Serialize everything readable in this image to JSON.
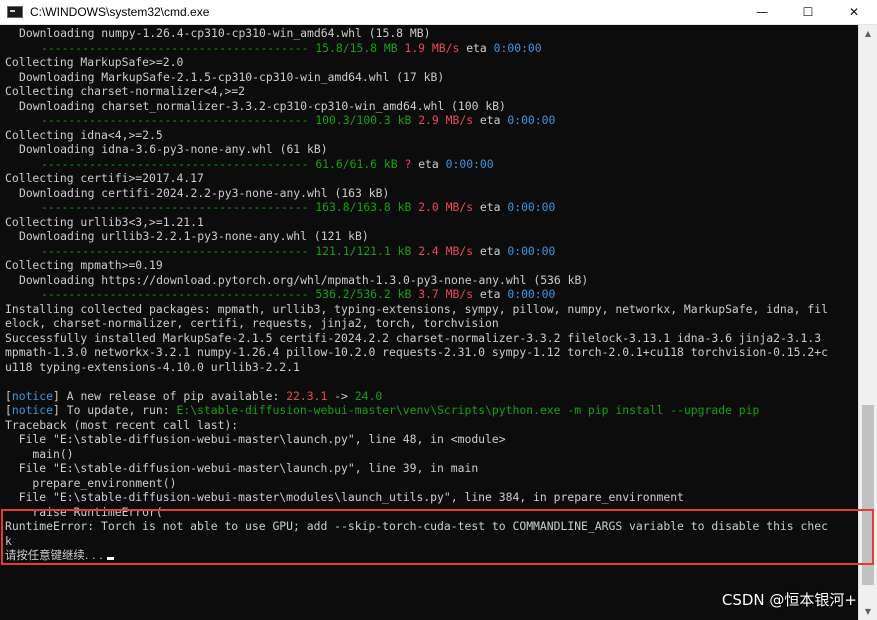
{
  "window": {
    "title": "C:\\WINDOWS\\system32\\cmd.exe",
    "minimize_glyph": "—",
    "maximize_glyph": "☐",
    "close_glyph": "✕"
  },
  "console": {
    "lines": [
      {
        "type": "plain",
        "indent": true,
        "text": "Downloading numpy-1.26.4-cp310-cp310-win_amd64.whl (15.8 MB)"
      },
      {
        "type": "progress",
        "bar": "---------------------------------------",
        "size": "15.8/15.8 MB",
        "speed": "1.9 MB/s",
        "eta_label": "eta",
        "eta": "0:00:00"
      },
      {
        "type": "plain",
        "indent": false,
        "text": "Collecting MarkupSafe>=2.0"
      },
      {
        "type": "plain",
        "indent": true,
        "text": "Downloading MarkupSafe-2.1.5-cp310-cp310-win_amd64.whl (17 kB)"
      },
      {
        "type": "plain",
        "indent": false,
        "text": "Collecting charset-normalizer<4,>=2"
      },
      {
        "type": "plain",
        "indent": true,
        "text": "Downloading charset_normalizer-3.3.2-cp310-cp310-win_amd64.whl (100 kB)"
      },
      {
        "type": "progress",
        "bar": "---------------------------------------",
        "size": "100.3/100.3 kB",
        "speed": "2.9 MB/s",
        "eta_label": "eta",
        "eta": "0:00:00"
      },
      {
        "type": "plain",
        "indent": false,
        "text": "Collecting idna<4,>=2.5"
      },
      {
        "type": "plain",
        "indent": true,
        "text": "Downloading idna-3.6-py3-none-any.whl (61 kB)"
      },
      {
        "type": "progress",
        "bar": "---------------------------------------",
        "size": "61.6/61.6 kB",
        "speed": "?",
        "eta_label": "eta",
        "eta": "0:00:00"
      },
      {
        "type": "plain",
        "indent": false,
        "text": "Collecting certifi>=2017.4.17"
      },
      {
        "type": "plain",
        "indent": true,
        "text": "Downloading certifi-2024.2.2-py3-none-any.whl (163 kB)"
      },
      {
        "type": "progress",
        "bar": "---------------------------------------",
        "size": "163.8/163.8 kB",
        "speed": "2.0 MB/s",
        "eta_label": "eta",
        "eta": "0:00:00"
      },
      {
        "type": "plain",
        "indent": false,
        "text": "Collecting urllib3<3,>=1.21.1"
      },
      {
        "type": "plain",
        "indent": true,
        "text": "Downloading urllib3-2.2.1-py3-none-any.whl (121 kB)"
      },
      {
        "type": "progress",
        "bar": "---------------------------------------",
        "size": "121.1/121.1 kB",
        "speed": "2.4 MB/s",
        "eta_label": "eta",
        "eta": "0:00:00"
      },
      {
        "type": "plain",
        "indent": false,
        "text": "Collecting mpmath>=0.19"
      },
      {
        "type": "plain",
        "indent": true,
        "text": "Downloading https://download.pytorch.org/whl/mpmath-1.3.0-py3-none-any.whl (536 kB)"
      },
      {
        "type": "progress",
        "bar": "---------------------------------------",
        "size": "536.2/536.2 kB",
        "speed": "3.7 MB/s",
        "eta_label": "eta",
        "eta": "0:00:00"
      },
      {
        "type": "plain",
        "indent": false,
        "text": "Installing collected packages: mpmath, urllib3, typing-extensions, sympy, pillow, numpy, networkx, MarkupSafe, idna, fil"
      },
      {
        "type": "plain",
        "indent": false,
        "text": "elock, charset-normalizer, certifi, requests, jinja2, torch, torchvision"
      },
      {
        "type": "plain",
        "indent": false,
        "text": "Successfully installed MarkupSafe-2.1.5 certifi-2024.2.2 charset-normalizer-3.3.2 filelock-3.13.1 idna-3.6 jinja2-3.1.3"
      },
      {
        "type": "plain",
        "indent": false,
        "text": "mpmath-1.3.0 networkx-3.2.1 numpy-1.26.4 pillow-10.2.0 requests-2.31.0 sympy-1.12 torch-2.0.1+cu118 torchvision-0.15.2+c"
      },
      {
        "type": "plain",
        "indent": false,
        "text": "u118 typing-extensions-4.10.0 urllib3-2.2.1"
      },
      {
        "type": "blank"
      },
      {
        "type": "notice",
        "tag": "notice",
        "text": " A new release of pip available: ",
        "old": "22.3.1",
        "arrow": " -> ",
        "new": "24.0"
      },
      {
        "type": "notice2",
        "tag": "notice",
        "text": " To update, run: ",
        "cmd": "E:\\stable-diffusion-webui-master\\venv\\Scripts\\python.exe -m pip install --upgrade pip"
      },
      {
        "type": "plain",
        "indent": false,
        "text": "Traceback (most recent call last):"
      },
      {
        "type": "plain",
        "indent": false,
        "text": "  File \"E:\\stable-diffusion-webui-master\\launch.py\", line 48, in <module>"
      },
      {
        "type": "plain",
        "indent": false,
        "text": "    main()"
      },
      {
        "type": "plain",
        "indent": false,
        "text": "  File \"E:\\stable-diffusion-webui-master\\launch.py\", line 39, in main"
      },
      {
        "type": "plain",
        "indent": false,
        "text": "    prepare_environment()"
      },
      {
        "type": "plain",
        "indent": false,
        "text": "  File \"E:\\stable-diffusion-webui-master\\modules\\launch_utils.py\", line 384, in prepare_environment"
      },
      {
        "type": "plain",
        "indent": false,
        "text": "    raise RuntimeError("
      },
      {
        "type": "plain",
        "indent": false,
        "text": "RuntimeError: Torch is not able to use GPU; add --skip-torch-cuda-test to COMMANDLINE_ARGS variable to disable this chec"
      },
      {
        "type": "plain",
        "indent": false,
        "text": "k"
      },
      {
        "type": "prompt",
        "text": "请按任意键继续. . ."
      }
    ]
  },
  "watermark": "CSDN @恒本银河+",
  "colors": {
    "background": "#0c0c0c",
    "text": "#cccccc",
    "progress_green": "#13a10e",
    "speed_red": "#e74856",
    "eta_cyan": "#3a96dd",
    "highlight": "#e8383b"
  }
}
